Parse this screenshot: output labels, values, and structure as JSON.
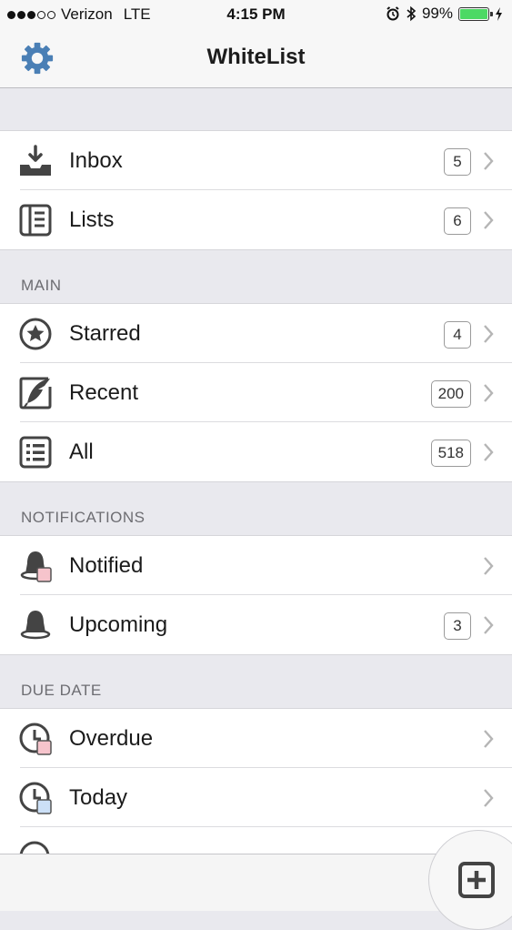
{
  "status_bar": {
    "carrier": "Verizon",
    "network": "LTE",
    "time": "4:15 PM",
    "battery": "99%",
    "battery_level": 0.99,
    "icons": [
      "signal-dots-icon",
      "alarm-icon",
      "bluetooth-icon",
      "battery-icon",
      "charging-bolt-icon"
    ]
  },
  "nav": {
    "title": "WhiteList",
    "left_icon": "gear-icon"
  },
  "top_group": [
    {
      "label": "Inbox",
      "count": "5",
      "icon": "inbox-tray-icon"
    },
    {
      "label": "Lists",
      "count": "6",
      "icon": "lists-icon"
    }
  ],
  "sections": {
    "main": {
      "header": "MAIN",
      "items": [
        {
          "label": "Starred",
          "count": "4",
          "icon": "star-circle-icon"
        },
        {
          "label": "Recent",
          "count": "200",
          "icon": "quill-icon"
        },
        {
          "label": "All",
          "count": "518",
          "icon": "list-all-icon"
        }
      ]
    },
    "notifications": {
      "header": "NOTIFICATIONS",
      "items": [
        {
          "label": "Notified",
          "count": "",
          "icon": "bell-red-icon"
        },
        {
          "label": "Upcoming",
          "count": "3",
          "icon": "bell-icon"
        }
      ]
    },
    "due_date": {
      "header": "DUE DATE",
      "items": [
        {
          "label": "Overdue",
          "count": "",
          "icon": "clock-red-icon"
        },
        {
          "label": "Today",
          "count": "",
          "icon": "clock-blue-icon"
        }
      ]
    }
  },
  "fab": {
    "icon": "add-square-icon"
  },
  "colors": {
    "accent": "#4a7fb5",
    "badge_border": "#9a9a9a",
    "red_tag": "#f6c4cc",
    "blue_tag": "#cce0f7",
    "battery": "#4cd964"
  }
}
